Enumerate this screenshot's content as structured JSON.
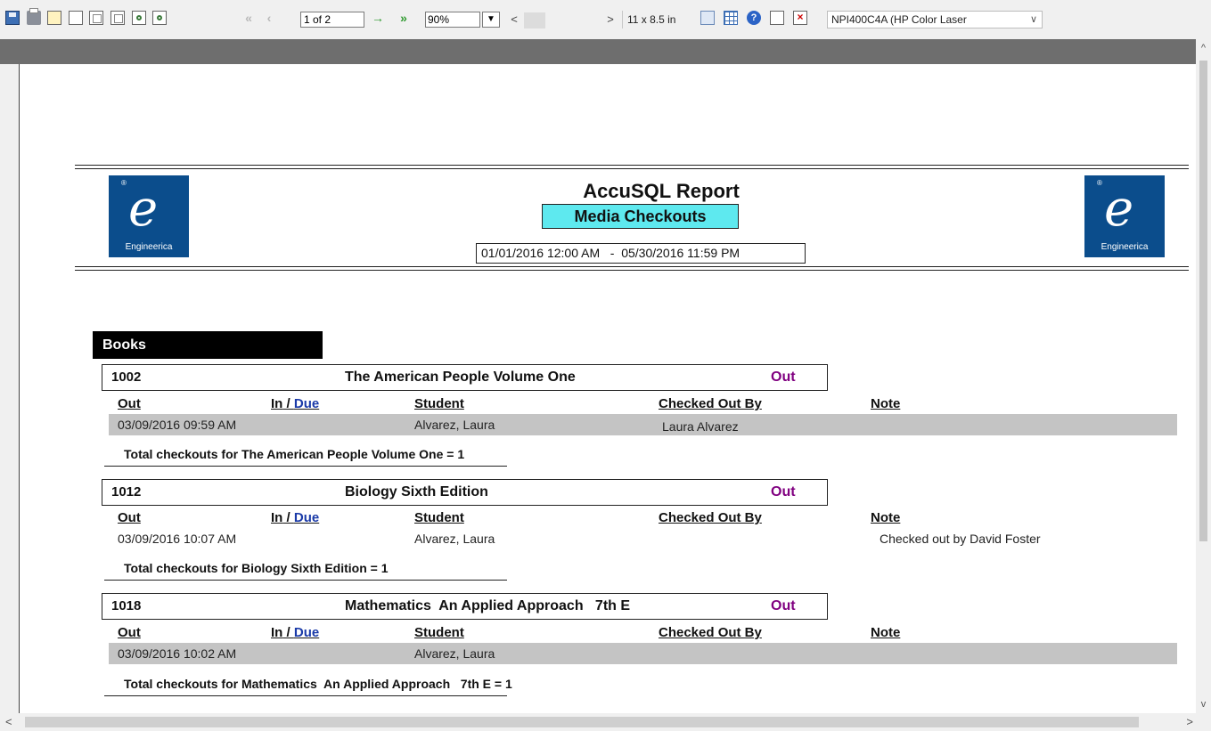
{
  "toolbar": {
    "page_value": "1 of 2",
    "zoom_value": "90%",
    "page_size": "11 x 8.5 in",
    "printer": "NPI400C4A (HP Color Laser",
    "icons": [
      "save-icon",
      "print-icon",
      "export-icon",
      "single-page-icon",
      "two-page-icon",
      "multi-page-icon",
      "zoom-in-icon",
      "zoom-out-icon",
      "first-page-icon",
      "prev-page-icon",
      "next-page-icon",
      "last-page-icon",
      "page-setup-icon",
      "grid-icon",
      "help-icon",
      "blank-page-icon",
      "close-icon"
    ]
  },
  "report": {
    "title": "AccuSQL Report",
    "subtitle": "Media Checkouts",
    "date_range": "01/01/2016 12:00 AM   -  05/30/2016 11:59 PM",
    "logo_text": "Engineerica",
    "category": "Books",
    "col_out": "Out",
    "col_in": "In",
    "col_slash": " / ",
    "col_due": "Due",
    "col_student": "Student",
    "col_checked_out_by": "Checked Out By",
    "col_note": "Note",
    "items": [
      {
        "id": "1002",
        "title": "The American People Volume One",
        "status": "Out",
        "out": "03/09/2016 09:59 AM",
        "student": "Alvarez, Laura",
        "checked_out_by": "Laura Alvarez",
        "note": "",
        "total": "Total checkouts for The American People Volume One = 1"
      },
      {
        "id": "1012",
        "title": "Biology Sixth Edition",
        "status": "Out",
        "out": "03/09/2016 10:07 AM",
        "student": "Alvarez, Laura",
        "checked_out_by": "",
        "note": "Checked out by David Foster",
        "total": "Total checkouts for Biology Sixth Edition = 1"
      },
      {
        "id": "1018",
        "title": "Mathematics  An Applied Approach   7th E",
        "status": "Out",
        "out": "03/09/2016 10:02 AM",
        "student": "Alvarez, Laura",
        "checked_out_by": "",
        "note": "",
        "total": "Total checkouts for Mathematics  An Applied Approach   7th E = 1"
      }
    ]
  },
  "colors": {
    "status_out": "#800080",
    "subtitle_bg": "#5ee9ef",
    "row_shade": "#c4c4c4",
    "due_link": "#1a3aa8"
  }
}
